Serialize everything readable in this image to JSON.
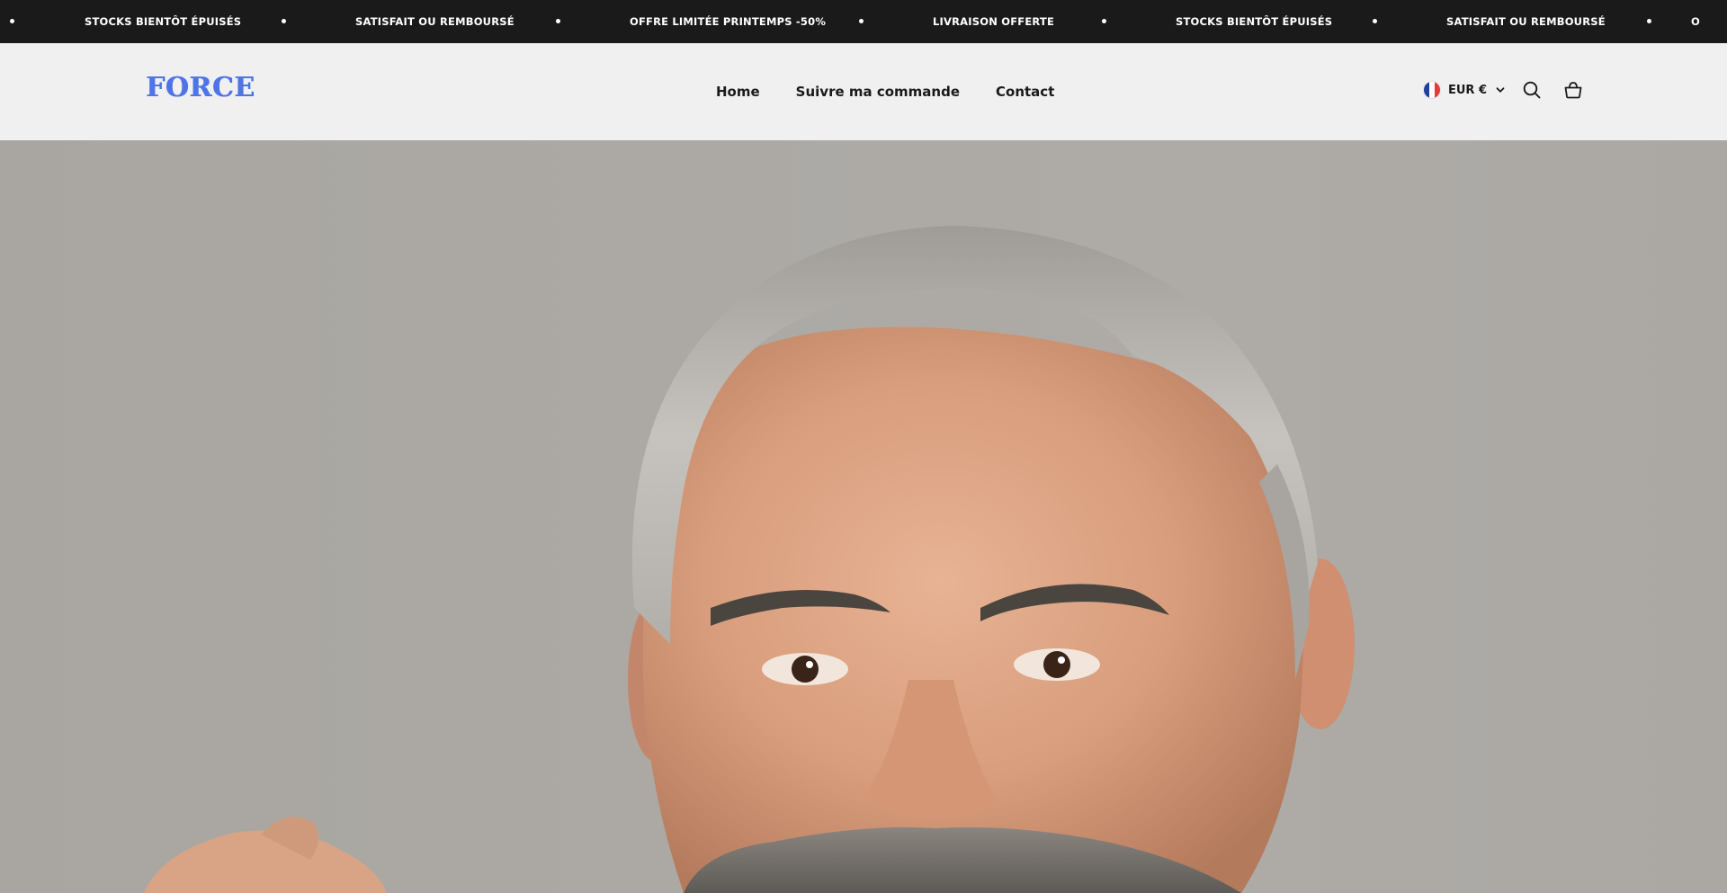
{
  "announcement": {
    "items": [
      "STOCKS BIENTÔT ÉPUISÉS",
      "SATISFAIT OU REMBOURSÉ",
      "OFFRE LIMITÉE PRINTEMPS -50%",
      "LIVRAISON OFFERTE",
      "STOCKS BIENTÔT ÉPUISÉS",
      "SATISFAIT OU REMBOURSÉ"
    ],
    "trailing_fragment": "O"
  },
  "header": {
    "logo": "FORCE",
    "nav": [
      {
        "label": "Home"
      },
      {
        "label": "Suivre ma commande"
      },
      {
        "label": "Contact"
      }
    ],
    "currency": "EUR €",
    "icons": {
      "flag": "france-flag-icon",
      "dropdown": "chevron-down-icon",
      "search": "search-icon",
      "cart": "shopping-basket-icon"
    }
  },
  "hero": {
    "image": "portrait of smiling grey-haired man with beard"
  },
  "colors": {
    "announcement_bg": "#1a1a1a",
    "header_bg": "#f0f0f0",
    "logo": "#4f74e8",
    "text": "#1a1a1a"
  }
}
